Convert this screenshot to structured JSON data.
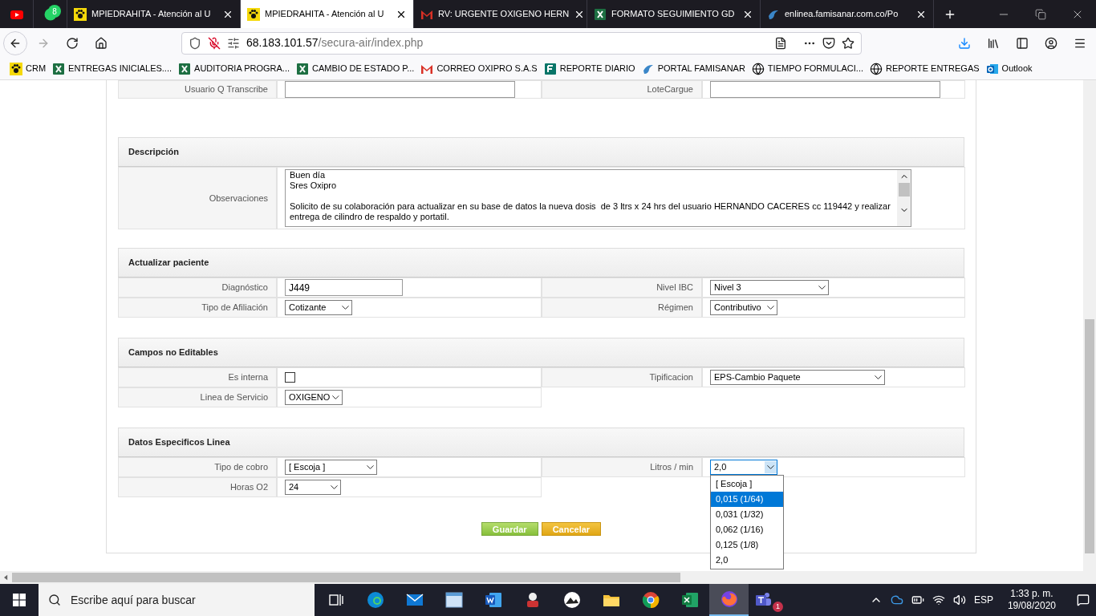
{
  "browser": {
    "tabs": [
      {
        "kind": "youtube",
        "pinned": true,
        "selected": false
      },
      {
        "kind": "whatsapp",
        "pinned": true,
        "selected": false,
        "badge": "8"
      },
      {
        "kind": "paw",
        "label": "MPIEDRAHITA - Atención al U",
        "pinned": false,
        "selected": false
      },
      {
        "kind": "paw",
        "label": "MPIEDRAHITA - Atención al U",
        "pinned": false,
        "selected": true
      },
      {
        "kind": "gmail",
        "label": "RV: URGENTE OXIGENO HERN",
        "pinned": false,
        "selected": false
      },
      {
        "kind": "excel",
        "label": "FORMATO SEGUIMIENTO GD",
        "pinned": false,
        "selected": false
      },
      {
        "kind": "famisanar",
        "label": "enlinea.famisanar.com.co/Po",
        "pinned": false,
        "selected": false
      }
    ],
    "url": {
      "host": "68.183.101.57",
      "path": "/secura-air/index.php"
    },
    "bookmarks": [
      {
        "kind": "paw",
        "label": "CRM"
      },
      {
        "kind": "excel",
        "label": "ENTREGAS INICIALES...."
      },
      {
        "kind": "excel",
        "label": "AUDITORIA PROGRA..."
      },
      {
        "kind": "excel",
        "label": "CAMBIO DE ESTADO P..."
      },
      {
        "kind": "gmail",
        "label": "CORREO OXIPRO S.A.S"
      },
      {
        "kind": "forms",
        "label": "REPORTE DIARIO"
      },
      {
        "kind": "famisanar",
        "label": "PORTAL FAMISANAR"
      },
      {
        "kind": "globe",
        "label": "TIEMPO FORMULACI..."
      },
      {
        "kind": "globe",
        "label": "REPORTE ENTREGAS"
      },
      {
        "kind": "outlook",
        "label": "Outlook"
      }
    ]
  },
  "form": {
    "top_row": [
      {
        "label": "Usuario Q Transcribe",
        "kind": "input"
      },
      {
        "label": "LoteCargue",
        "kind": "input"
      }
    ],
    "sections": [
      {
        "title": "Descripción",
        "rows": [
          [
            {
              "label": "Observaciones",
              "kind": "textarea",
              "paragraphs": [
                [
                  "Buen día",
                  "Sres Oxipro"
                ],
                [
                  "Solicito de su colaboración para actualizar en su base de datos la nueva dosis  de 3 ltrs x 24 hrs del usuario HERNANDO CACERES cc 119442 y realizar entrega de cilindro de respaldo y portatil."
                ]
              ]
            }
          ]
        ]
      },
      {
        "title": "Actualizar paciente",
        "rows": [
          [
            {
              "label": "Diagnóstico",
              "kind": "input",
              "value": "J449"
            },
            {
              "label": "Nivel IBC",
              "kind": "select",
              "value": "Nivel 3"
            }
          ],
          [
            {
              "label": "Tipo de Afiliación",
              "kind": "select",
              "value": "Cotizante"
            },
            {
              "label": "Régimen",
              "kind": "select",
              "value": "Contributivo"
            }
          ]
        ]
      },
      {
        "title": "Campos no Editables",
        "rows": [
          [
            {
              "label": "Es interna",
              "kind": "checkbox",
              "checked": false
            },
            {
              "label": "Tipificacion",
              "kind": "select",
              "value": "EPS-Cambio Paquete"
            }
          ],
          [
            {
              "label": "Linea de Servicio",
              "kind": "select",
              "value": "OXIGENO"
            }
          ]
        ]
      },
      {
        "title": "Datos Especificos Linea",
        "rows": [
          [
            {
              "label": "Tipo de cobro",
              "kind": "select",
              "value": "[ Escoja ]"
            },
            {
              "label": "Litros / min",
              "kind": "select",
              "value": "2,0",
              "open": true
            }
          ],
          [
            {
              "label": "Horas O2",
              "kind": "select",
              "value": "24"
            }
          ]
        ],
        "dropdown_options": [
          {
            "label": "[ Escoja ]",
            "selected": false
          },
          {
            "label": "0,015 (1/64)",
            "selected": true
          },
          {
            "label": "0,031 (1/32)",
            "selected": false
          },
          {
            "label": "0,062 (1/16)",
            "selected": false
          },
          {
            "label": "0,125 (1/8)",
            "selected": false
          },
          {
            "label": "2,0",
            "selected": false
          }
        ]
      }
    ],
    "buttons": [
      {
        "label": "Guardar",
        "kind": "save"
      },
      {
        "label": "Cancelar",
        "kind": "cancel"
      }
    ]
  },
  "taskbar": {
    "search": {
      "placeholder": "Escribe aquí para buscar"
    },
    "apps": [
      {
        "kind": "taskview",
        "active": false
      },
      {
        "kind": "edge",
        "active": false
      },
      {
        "kind": "mail",
        "active": false
      },
      {
        "kind": "window",
        "active": false
      },
      {
        "kind": "word",
        "active": false
      },
      {
        "kind": "pdf",
        "active": false
      },
      {
        "kind": "photos",
        "active": false
      },
      {
        "kind": "folder",
        "active": false
      },
      {
        "kind": "chrome",
        "active": false
      },
      {
        "kind": "excel",
        "active": false
      },
      {
        "kind": "firefox",
        "active": true
      },
      {
        "kind": "teams",
        "active": false,
        "badge": "1"
      }
    ],
    "language": "ESP",
    "time": "1:33 p. m.",
    "date": "19/08/2020"
  }
}
